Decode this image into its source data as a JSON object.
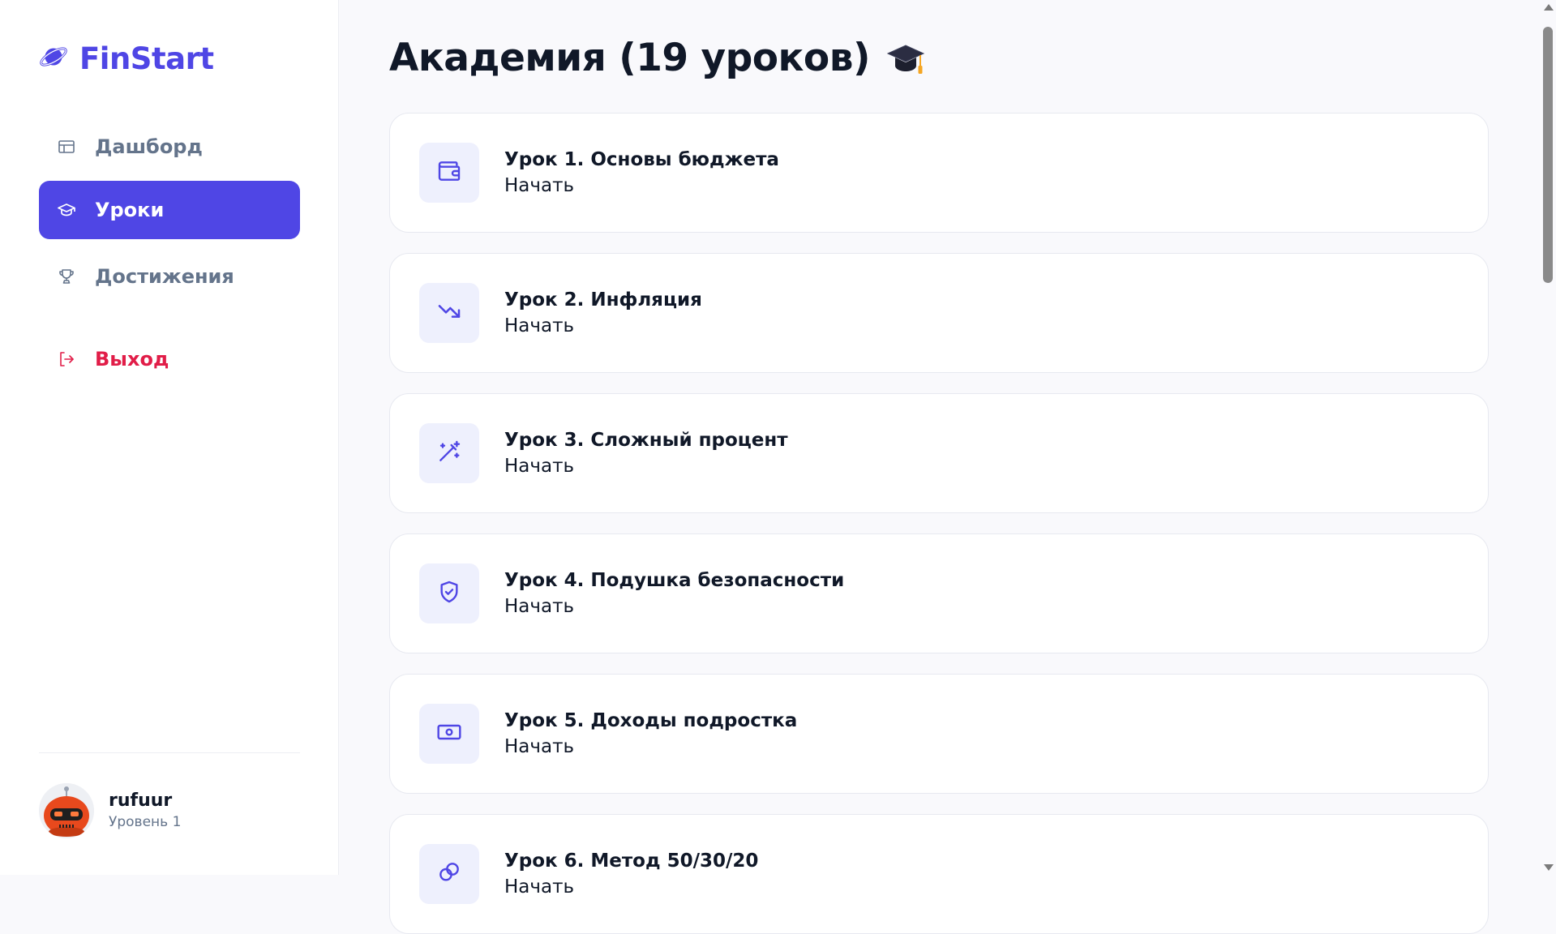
{
  "brand": {
    "name": "FinStart",
    "accent": "#4f46e5"
  },
  "sidebar": {
    "items": [
      {
        "label": "Дашборд",
        "icon": "layout-icon",
        "active": false
      },
      {
        "label": "Уроки",
        "icon": "graduation-cap-icon",
        "active": true
      },
      {
        "label": "Достижения",
        "icon": "trophy-icon",
        "active": false
      }
    ],
    "logout_label": "Выход",
    "logout_color": "#e11d48"
  },
  "user": {
    "name": "rufuur",
    "level": "Уровень 1",
    "avatar": "robot-avatar"
  },
  "main": {
    "title": "Академия (19 уроков)",
    "title_emoji": "graduation-cap-emoji",
    "lessons": [
      {
        "title": "Урок 1. Основы бюджета",
        "status": "Начать",
        "icon": "wallet-icon"
      },
      {
        "title": "Урок 2. Инфляция",
        "status": "Начать",
        "icon": "trending-down-icon"
      },
      {
        "title": "Урок 3. Сложный процент",
        "status": "Начать",
        "icon": "magic-wand-icon"
      },
      {
        "title": "Урок 4. Подушка безопасности",
        "status": "Начать",
        "icon": "shield-check-icon"
      },
      {
        "title": "Урок 5. Доходы подростка",
        "status": "Начать",
        "icon": "banknote-icon"
      },
      {
        "title": "Урок 6. Метод 50/30/20",
        "status": "Начать",
        "icon": "coins-icon"
      }
    ]
  }
}
